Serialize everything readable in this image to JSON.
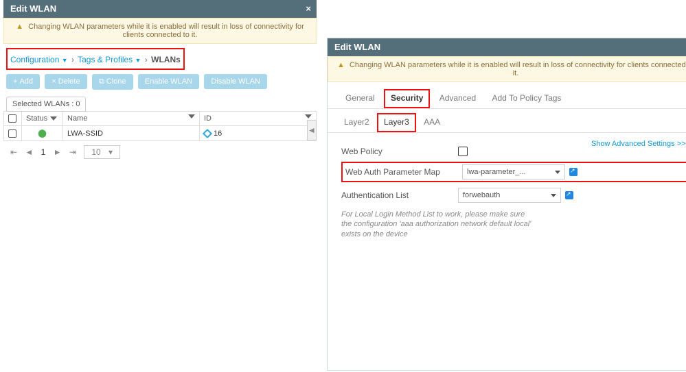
{
  "left": {
    "title": "Edit WLAN",
    "warning": "Changing WLAN parameters while it is enabled will result in loss of connectivity for clients connected to it.",
    "breadcrumb": {
      "a": "Configuration",
      "b": "Tags & Profiles",
      "c": "WLANs"
    },
    "toolbar": {
      "add": "Add",
      "delete": "Delete",
      "clone": "Clone",
      "enable": "Enable WLAN",
      "disable": "Disable WLAN"
    },
    "selected": "Selected WLANs : 0",
    "cols": {
      "status": "Status",
      "name": "Name",
      "id": "ID"
    },
    "row": {
      "name": "LWA-SSID",
      "id": "16"
    },
    "pager": {
      "page": "1",
      "size": "10"
    }
  },
  "right": {
    "title": "Edit WLAN",
    "warning": "Changing WLAN parameters while it is enabled will result in loss of connectivity for clients connected to it.",
    "tabs": {
      "general": "General",
      "security": "Security",
      "advanced": "Advanced",
      "policy": "Add To Policy Tags"
    },
    "subtabs": {
      "l2": "Layer2",
      "l3": "Layer3",
      "aaa": "AAA"
    },
    "adv": "Show Advanced Settings >>>",
    "form": {
      "web_policy": "Web Policy",
      "param_map_lbl": "Web Auth Parameter Map",
      "param_map_val": "lwa-parameter_...",
      "auth_list_lbl": "Authentication List",
      "auth_list_val": "forwebauth",
      "note1": "For Local Login Method List to work, please make sure",
      "note2": "the configuration 'aaa authorization network default local'",
      "note3": "exists on the device"
    }
  }
}
